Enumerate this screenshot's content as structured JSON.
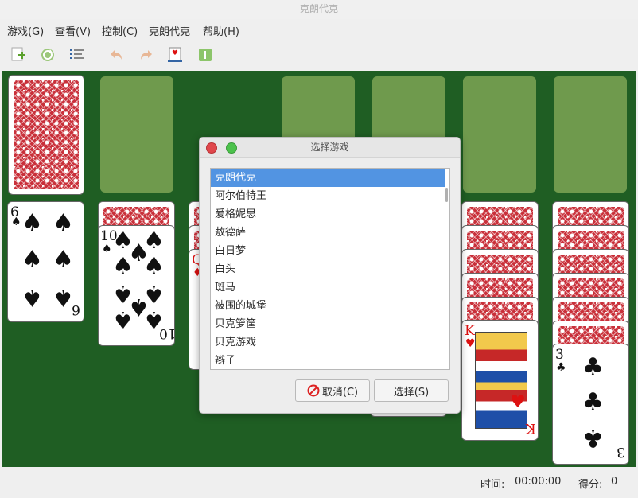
{
  "window": {
    "title": "克朗代克"
  },
  "menu": [
    "游戏(G)",
    "查看(V)",
    "控制(C)",
    "克朗代克",
    "帮助(H)"
  ],
  "toolbar": [
    "new-game-icon",
    "restart-icon",
    "choose-game-icon",
    "undo-icon",
    "redo-icon",
    "deal-icon",
    "hint-icon"
  ],
  "cards": {
    "six_spades": {
      "rank": "6",
      "suit": "♠"
    },
    "ten_spades": {
      "rank": "10",
      "suit": "♠"
    },
    "queen_diamonds": {
      "rank": "Q",
      "suit": "♦"
    },
    "king_hearts": {
      "rank": "K",
      "suit": "♥"
    },
    "three_clubs": {
      "rank": "3",
      "suit": "♣"
    }
  },
  "dialog": {
    "title": "选择游戏",
    "games": [
      "克朗代克",
      "阿尔伯特王",
      "爱格妮思",
      "敖德萨",
      "白日梦",
      "白头",
      "斑马",
      "被围的城堡",
      "贝克箩筐",
      "贝克游戏",
      "辫子"
    ],
    "selected_index": 0,
    "cancel_label": "取消(C)",
    "select_label": "选择(S)"
  },
  "status": {
    "time_label": "时间:",
    "time_value": "00:00:00",
    "score_label": "得分:",
    "score_value": "0"
  },
  "colors": {
    "table": "#1f5e23",
    "slot": "#6f9a4d",
    "selection": "#5294e2",
    "card_back": "#c9303a"
  }
}
